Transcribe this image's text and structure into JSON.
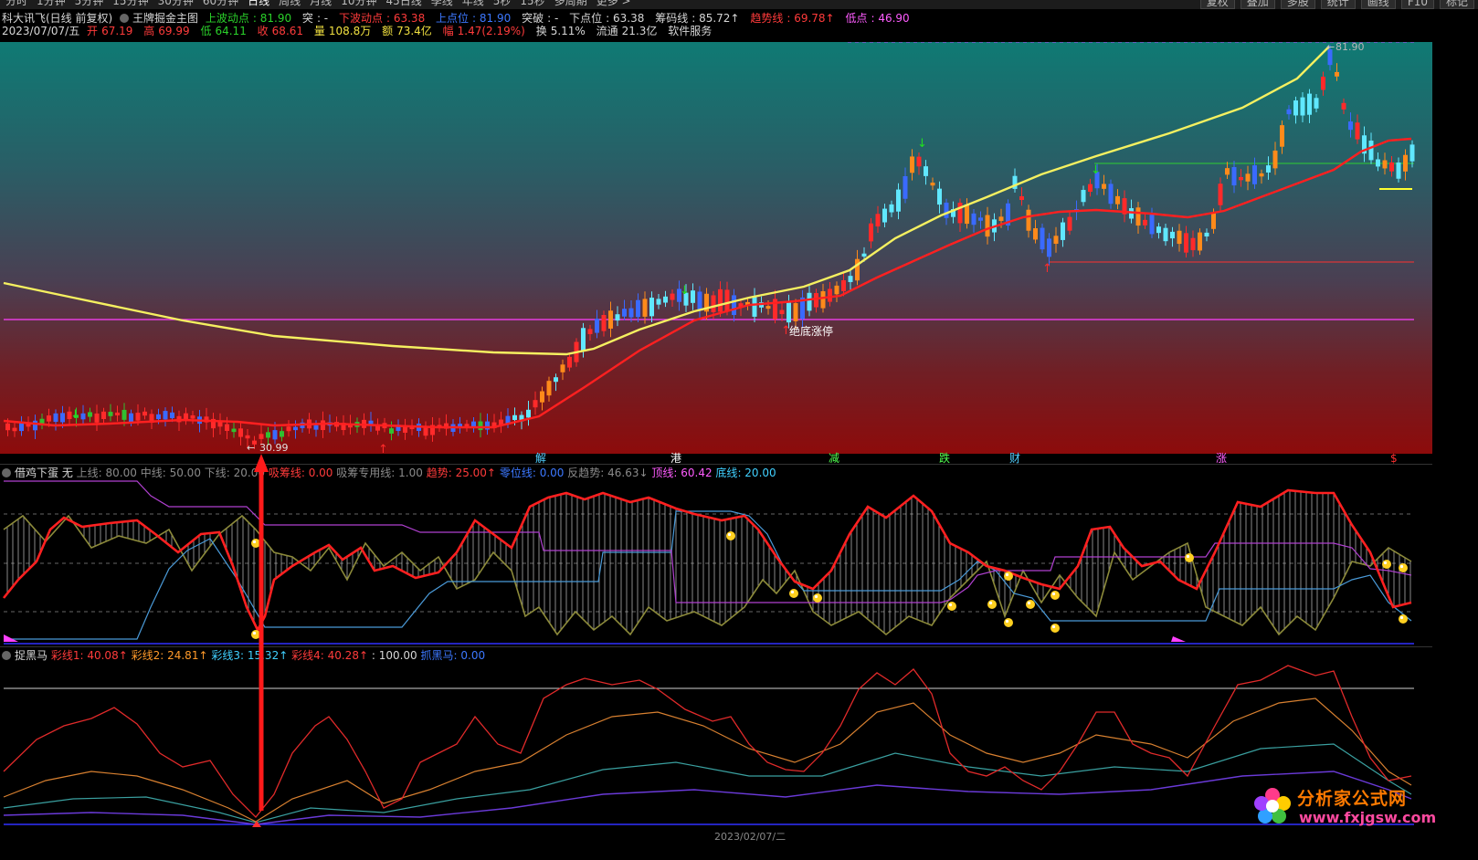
{
  "toolbar": {
    "tabs": [
      "分时",
      "1分钟",
      "5分钟",
      "15分钟",
      "30分钟",
      "60分钟",
      "日线",
      "周线",
      "月线",
      "10分钟",
      "45日线",
      "季线",
      "年线",
      "5秒",
      "15秒",
      "多周期",
      "更多 >"
    ],
    "active": "日线",
    "right_tabs": [
      "复权",
      "叠加",
      "多股",
      "统计",
      "画线",
      "F10",
      "标记"
    ]
  },
  "header": {
    "title": "科大讯飞(日线 前复权)",
    "indicator": "王牌掘金主图",
    "up_label": "上波动点",
    "up_val": "81.90",
    "sudden_label": "突",
    "sudden_val": "-",
    "down_label": "下波动点",
    "down_val": "63.38",
    "upper_label": "上点位",
    "upper_val": "81.90",
    "break_label": "突破",
    "break_val": "-",
    "lower_label": "下点位",
    "lower_val": "63.38",
    "chip_label": "筹码线",
    "chip_val": "85.72↑",
    "trend_label": "趋势线",
    "trend_val": "69.78↑",
    "low_label": "低点",
    "low_val": "46.90"
  },
  "quote": {
    "date": "2023/07/07/五",
    "open_label": "开",
    "open": "67.19",
    "high_label": "高",
    "high": "69.99",
    "low_label": "低",
    "low": "64.11",
    "close_label": "收",
    "close": "68.61",
    "vol_label": "量",
    "vol": "108.8万",
    "amt_label": "额",
    "amt": "73.4亿",
    "range_label": "幅",
    "range": "1.47(2.19%)",
    "turn_label": "换",
    "turn": "5.11%",
    "float_label": "流通",
    "float": "21.3亿",
    "sector": "软件服务"
  },
  "annotations": {
    "high_price": "81.90",
    "low_price": "30.99",
    "signal": "绝底涨停"
  },
  "events": [
    "解",
    "港",
    "减",
    "跌",
    "财",
    "涨",
    "$"
  ],
  "panel2": {
    "name": "借鸡下蛋 无",
    "upper_label": "上线",
    "upper": "80.00",
    "mid_label": "中线",
    "mid": "50.00",
    "lower_label": "下线",
    "lower": "20.00",
    "p4_label": "吸筹线",
    "p4": "0.00",
    "p5_label": "吸筹专用线",
    "p5": "1.00",
    "trend_label": "趋势",
    "trend": "25.00↑",
    "stop_label": "零位线",
    "stop": "0.00",
    "rev_label": "反趋势",
    "rev": "46.63↓",
    "top_label": "顶线",
    "top": "60.42",
    "bottom_label": "底线",
    "bottom": "20.00"
  },
  "panel3": {
    "name": "捉黑马",
    "c1_label": "彩线1",
    "c1": "40.08↑",
    "c2_label": "彩线2",
    "c2": "24.81↑",
    "c3_label": "彩线3",
    "c3": "15.32↑",
    "c4_label": "彩线4",
    "c4": "40.28↑",
    "c5": ": 100.00",
    "c6_label": "抓黑马",
    "c6": "0.00"
  },
  "bottom_axis": {
    "date_label": "2023/02/07/二"
  },
  "watermark": {
    "title": "分析家公式网",
    "url": "www.fxjgsw.com"
  },
  "colors": {
    "up": "#ff2a2a",
    "down": "#40e0ff",
    "ma_slow": "#f5f060",
    "ma_fast": "#ff2020",
    "magenta": "#ff40ff"
  }
}
